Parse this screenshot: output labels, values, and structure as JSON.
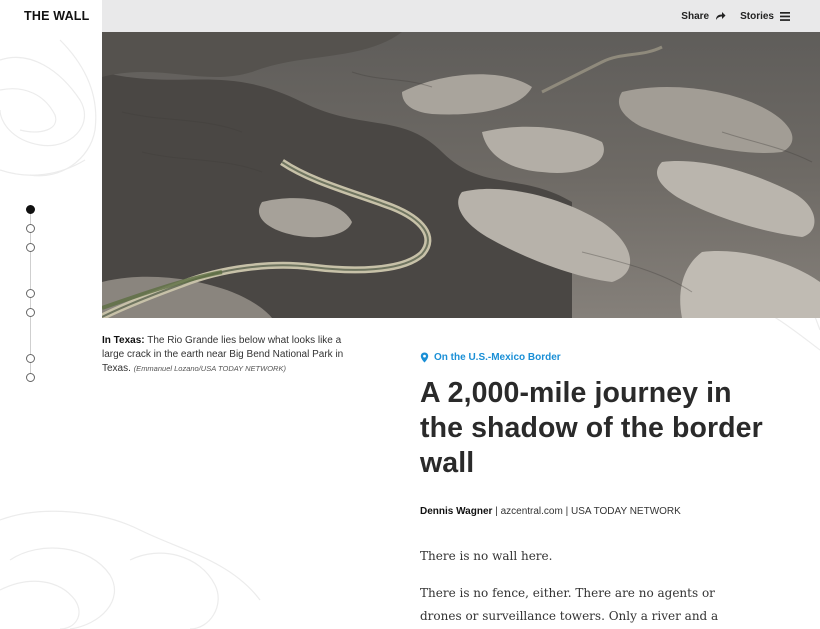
{
  "brand": {
    "title": "THE WALL"
  },
  "nav": {
    "share_label": "Share",
    "share_icon": "share-arrow-icon",
    "stories_label": "Stories",
    "stories_icon": "hamburger-menu-icon"
  },
  "hero": {
    "subject": "Aerial view of the Rio Grande winding through canyon terrain"
  },
  "progress": {
    "total": 7,
    "active_index": 0
  },
  "caption": {
    "lead": "In Texas:",
    "text": " The Rio Grande lies below what looks like a large crack in the earth near Big Bend National Park in Texas. ",
    "credit": "(Emmanuel Lozano/USA TODAY NETWORK)"
  },
  "article": {
    "kicker": "On the U.S.-Mexico Border",
    "kicker_icon": "location-pin-icon",
    "headline": "A 2,000-mile journey in the shadow of the border wall",
    "author": "Dennis Wagner",
    "byline_rest": " | azcentral.com | USA TODAY NETWORK",
    "paragraphs": [
      "There is no wall here.",
      "There is no fence, either. There are no agents or drones or surveillance towers. Only a river and a breeze."
    ]
  },
  "colors": {
    "accent": "#1a8fd6",
    "topbar": "#e9e9ea",
    "text": "#2a2a2a"
  }
}
